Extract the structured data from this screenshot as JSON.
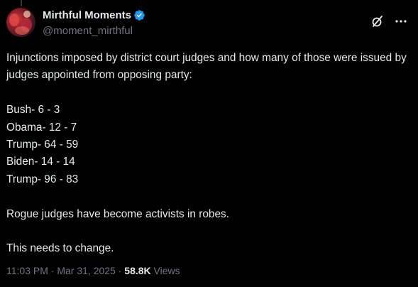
{
  "author": {
    "display_name": "Mirthful Moments",
    "handle": "@moment_mirthful",
    "verified": true,
    "verified_color": "#1d9bf0"
  },
  "icons": {
    "grok": "grok-icon",
    "more": "more-options-icon",
    "verified": "verified-badge-icon"
  },
  "tweet": {
    "intro": "Injunctions imposed by district court judges and how many of those were issued by judges appointed from opposing party:",
    "stats": [
      "Bush- 6 - 3",
      "Obama- 12 - 7",
      "Trump- 64 - 59",
      "Biden- 14 - 14",
      "Trump- 96 - 83"
    ],
    "line1": "Rogue judges have become activists in robes.",
    "line2": "This needs to change."
  },
  "meta": {
    "time": "11:03 PM",
    "separator": " · ",
    "date": "Mar 31, 2025",
    "views_count": "58.8K",
    "views_label": "Views"
  },
  "colors": {
    "background": "#000000",
    "text": "#e7e9ea",
    "secondary": "#71767b"
  }
}
